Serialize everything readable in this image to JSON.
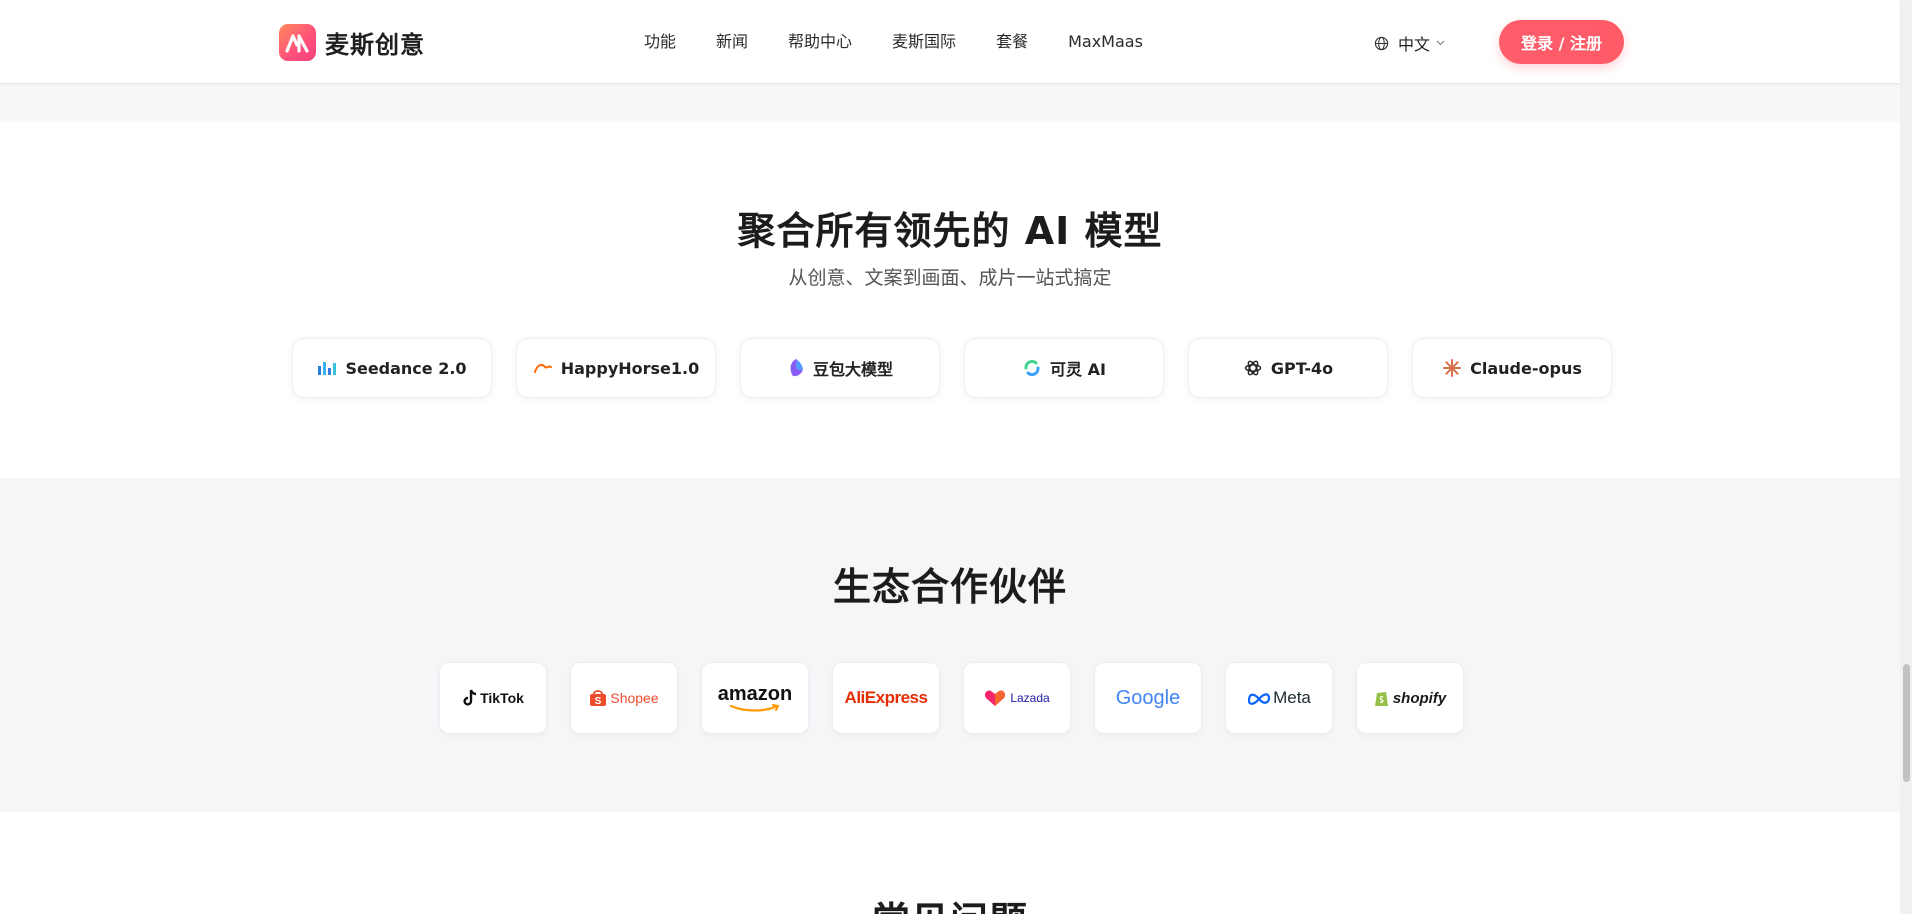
{
  "header": {
    "brand": "麦斯创意",
    "nav": [
      "功能",
      "新闻",
      "帮助中心",
      "麦斯国际",
      "套餐",
      "MaxMaas"
    ],
    "language": "中文",
    "login_label": "登录 / 注册",
    "brand_color": "#ff5a66"
  },
  "models_section": {
    "title": "聚合所有领先的 AI 模型",
    "subtitle": "从创意、文案到画面、成片一站式搞定",
    "models": [
      {
        "name": "Seedance 2.0",
        "icon": "seedance-icon"
      },
      {
        "name": "HappyHorse1.0",
        "icon": "happyhorse-icon"
      },
      {
        "name": "豆包大模型",
        "icon": "doubao-icon"
      },
      {
        "name": "可灵 AI",
        "icon": "kling-icon"
      },
      {
        "name": "GPT-4o",
        "icon": "openai-icon"
      },
      {
        "name": "Claude-opus",
        "icon": "claude-icon"
      }
    ]
  },
  "partners_section": {
    "title": "生态合作伙伴",
    "partners": [
      "TikTok",
      "Shopee",
      "amazon",
      "AliExpress",
      "Lazada",
      "Google",
      "Meta",
      "shopify"
    ]
  },
  "faq_section": {
    "title": "常见问题"
  }
}
